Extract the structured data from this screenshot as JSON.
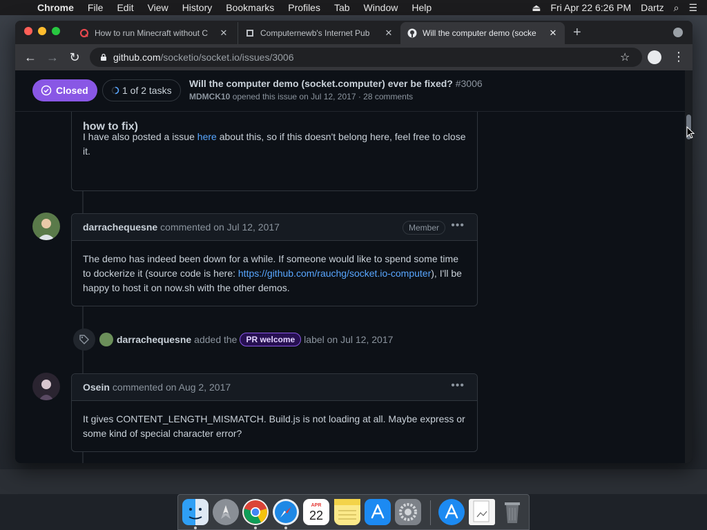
{
  "menubar": {
    "app": "Chrome",
    "items": [
      "File",
      "Edit",
      "View",
      "History",
      "Bookmarks",
      "Profiles",
      "Tab",
      "Window",
      "Help"
    ],
    "datetime": "Fri Apr 22  6:26 PM",
    "user": "Dartz"
  },
  "tabs": [
    {
      "title": "How to run Minecraft without C",
      "close": "✕"
    },
    {
      "title": "Computernewb's Internet Pub",
      "close": "✕"
    },
    {
      "title": "Will the computer demo (socke",
      "close": "✕"
    }
  ],
  "newtab": "+",
  "address": {
    "host": "github.com",
    "path": "/socketio/socket.io/issues/3006"
  },
  "issue": {
    "state": "Closed",
    "tasks": "1 of 2 tasks",
    "title": "Will the computer demo (socket.computer) ever be fixed?",
    "number": "#3006",
    "author": "MDMCK10",
    "meta": "opened this issue on Jul 12, 2017 · 28 comments"
  },
  "comments": [
    {
      "partial_heading": "how to fix)",
      "body_pre": "I have also posted a issue ",
      "link": "here",
      "body_post": " about this, so if this doesn't belong here, feel free to close it."
    },
    {
      "author": "darrachequesne",
      "action": "commented on Jul 12, 2017",
      "badge": "Member",
      "body_pre": "The demo has indeed been down for a while. If someone would like to spend some time to dockerize it (source code is here: ",
      "link": "https://github.com/rauchg/socket.io-computer",
      "body_post": "), I'll be happy to host it on now.sh with the other demos."
    },
    {
      "author": "Osein",
      "action": "commented on Aug 2, 2017",
      "body": "It gives CONTENT_LENGTH_MISMATCH. Build.js is not loading at all. Maybe express or some kind of special character error?"
    }
  ],
  "label_event": {
    "author": "darrachequesne",
    "added": "added the",
    "label": "PR welcome",
    "tail": "label on Jul 12, 2017"
  },
  "dock": {
    "items": [
      "Finder",
      "Launchpad",
      "Chrome",
      "Safari",
      "Calendar",
      "Notes",
      "App Store",
      "System Preferences",
      "App Store",
      "Preview",
      "Trash"
    ],
    "calendar_month": "APR",
    "calendar_day": "22"
  },
  "colors": {
    "closed": "#8957e5",
    "link": "#58a6ff",
    "bg": "#0d1117"
  }
}
